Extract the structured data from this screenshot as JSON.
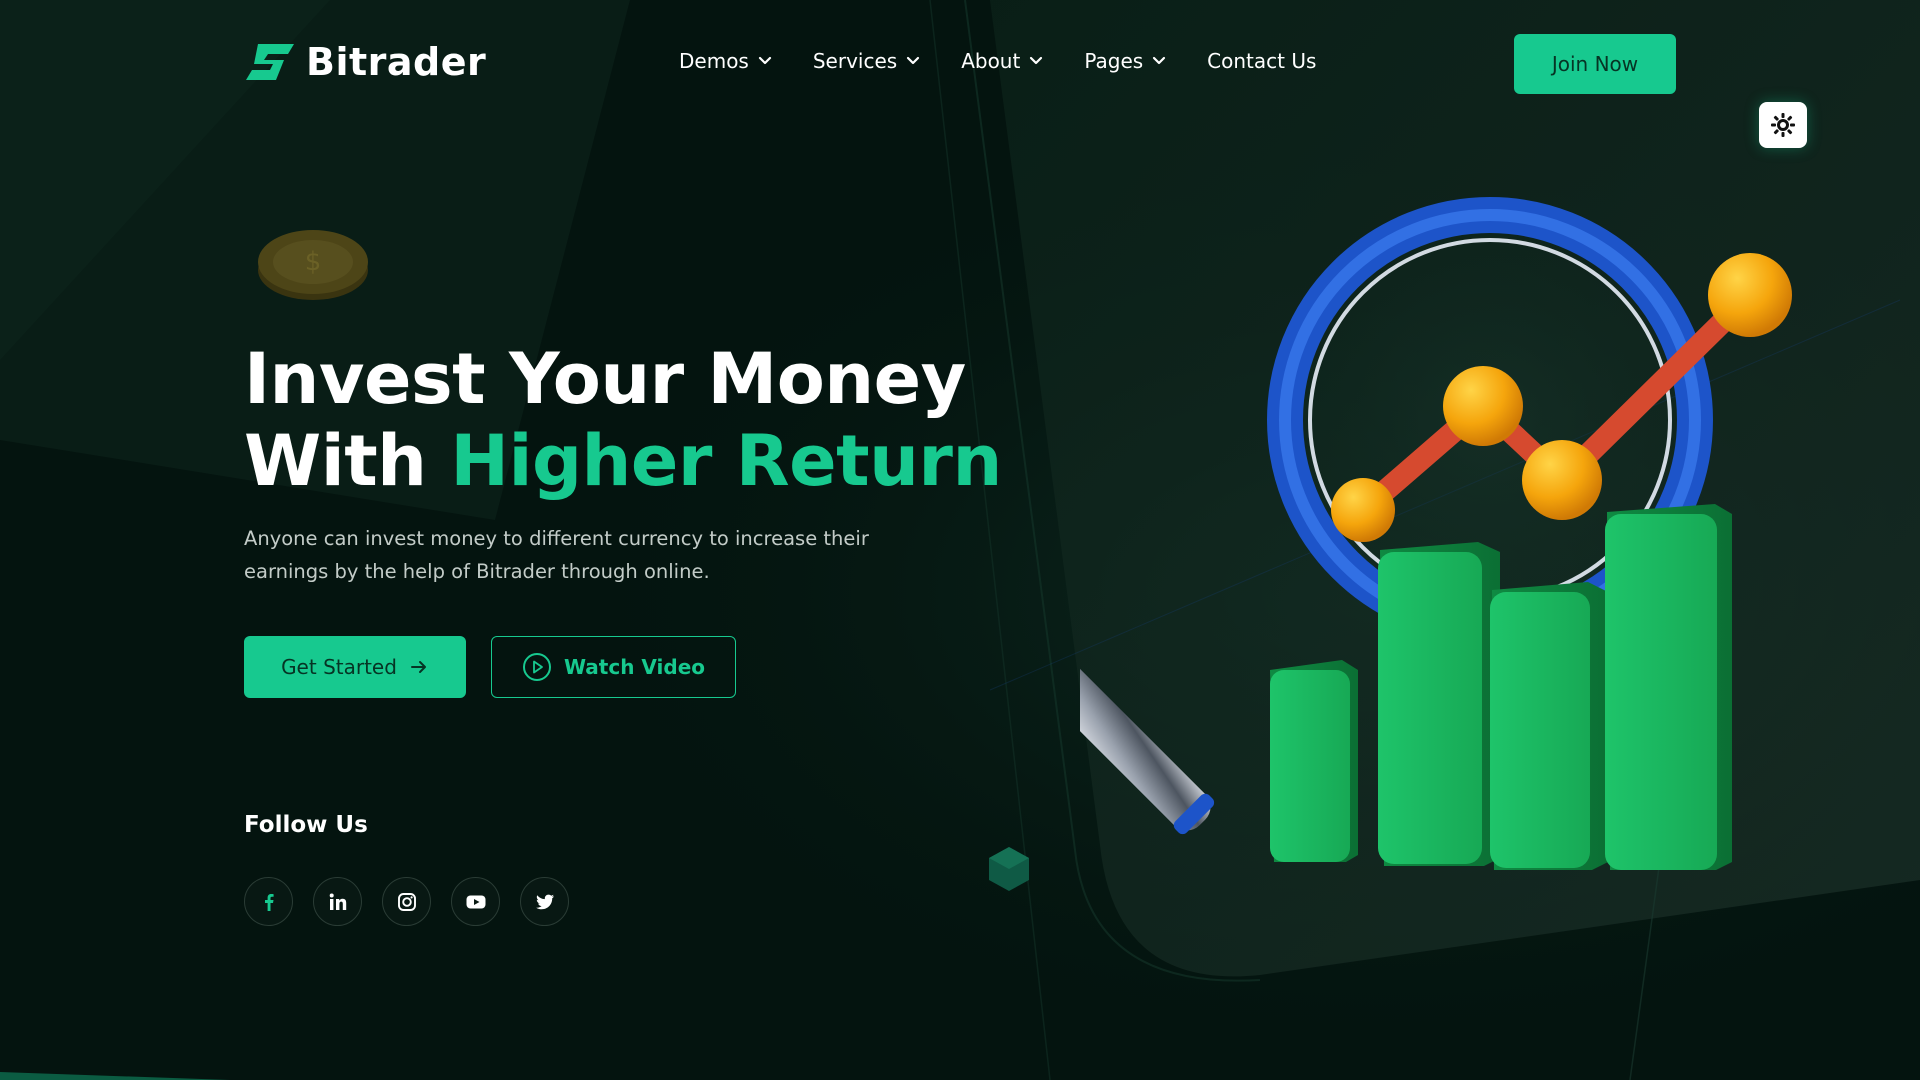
{
  "brand": {
    "name": "Bitrader",
    "accent": "#17c98f",
    "background": "#04140f"
  },
  "nav": {
    "items": [
      {
        "label": "Demos",
        "has_dropdown": true
      },
      {
        "label": "Services",
        "has_dropdown": true
      },
      {
        "label": "About",
        "has_dropdown": true
      },
      {
        "label": "Pages",
        "has_dropdown": true
      },
      {
        "label": "Contact Us",
        "has_dropdown": false
      }
    ],
    "cta_label": "Join Now"
  },
  "theme_toggle": {
    "icon": "sun-icon"
  },
  "hero": {
    "title_line1": "Invest Your Money",
    "title_line2_prefix": "With ",
    "title_line2_accent": "Higher Return",
    "description": "Anyone can invest money to different currency to increase their earnings by the help of Bitrader through online.",
    "primary_button": {
      "label": "Get Started",
      "icon": "arrow-right-icon"
    },
    "secondary_button": {
      "label": "Watch Video",
      "icon": "play-circle-icon"
    }
  },
  "follow": {
    "title": "Follow Us",
    "socials": [
      {
        "name": "facebook",
        "icon": "facebook-icon"
      },
      {
        "name": "linkedin",
        "icon": "linkedin-icon"
      },
      {
        "name": "instagram",
        "icon": "instagram-icon"
      },
      {
        "name": "youtube",
        "icon": "youtube-icon"
      },
      {
        "name": "twitter",
        "icon": "twitter-icon"
      }
    ]
  },
  "illustration": {
    "icon": "magnifier-growth-chart-illustration"
  }
}
